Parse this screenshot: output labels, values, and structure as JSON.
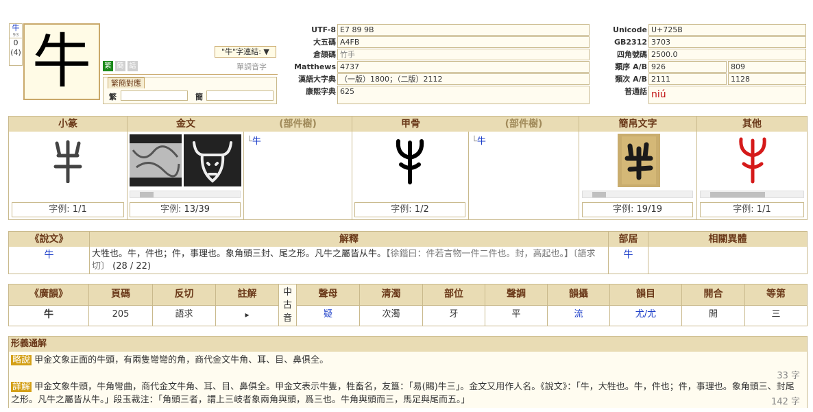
{
  "header": {
    "main_char": "牛",
    "mini_char": "牛",
    "mini_num": "93",
    "stroke_zero": "0",
    "stroke_total": "(4)",
    "btn_trad": "繁",
    "btn_simp": "簡",
    "btn_other": "話",
    "link_select": "\"牛\"字連結: ▼",
    "single_font": "單調音字",
    "tab_label": "繁簡對應",
    "trad_label": "繁",
    "simp_label": "簡"
  },
  "codes_left": [
    {
      "label": "UTF-8",
      "value": "E7 89 9B"
    },
    {
      "label": "大五碼",
      "value": "A4FB"
    },
    {
      "label": "倉頡碼",
      "value": "竹手"
    },
    {
      "label": "Matthews",
      "value": "4737"
    },
    {
      "label": "漢語大字典",
      "value": "（一版）1800；（二版）2112"
    },
    {
      "label": "康熙字典",
      "value": "625"
    }
  ],
  "codes_right": [
    {
      "label": "Unicode",
      "value": "U+725B"
    },
    {
      "label": "GB2312",
      "value": "3703"
    },
    {
      "label": "四角號碼",
      "value": "2500.0"
    },
    {
      "label": "類序 A/B",
      "value": "926",
      "value2": "809"
    },
    {
      "label": "類次 A/B",
      "value": "2111",
      "value2": "1128"
    },
    {
      "label": "普通話",
      "value": "niú"
    }
  ],
  "scripts": {
    "headers": [
      "小篆",
      "金文",
      "(部件樹)",
      "甲骨",
      "(部件樹)",
      "簡帛文字",
      "其他"
    ],
    "tree_char_1": "牛",
    "tree_char_2": "牛",
    "counts": [
      {
        "prefix": "字例: ",
        "value": "1/1"
      },
      {
        "prefix": "字例: ",
        "value": "13/39"
      },
      {
        "prefix": "字例: ",
        "value": "1/2"
      },
      {
        "prefix": "字例: ",
        "value": "19/19"
      },
      {
        "prefix": "字例: ",
        "value": "1/1"
      }
    ]
  },
  "shuowen": {
    "headers": [
      "《說文》",
      "解釋",
      "部居",
      "相關異體"
    ],
    "char": "牛",
    "text_main": "大牲也。牛，件也；件，事理也。象角頭三封、尾之形。凡牛之屬皆从牛。",
    "text_note": "【徐鍇曰：件若言物一件二件也。封，高起也。】〔語求切〕",
    "text_ref": "(28 / 22)",
    "radical": "牛",
    "variants": ""
  },
  "guangyun": {
    "headers": [
      "《廣韻》",
      "頁碼",
      "反切",
      "註解",
      "聲母",
      "清濁",
      "部位",
      "聲調",
      "韻攝",
      "韻目",
      "開合",
      "等第"
    ],
    "middle_label": "中古音",
    "values": [
      "牛",
      "205",
      "語求",
      "▸",
      "疑",
      "次濁",
      "牙",
      "平",
      "流",
      "尤/尤",
      "開",
      "三"
    ]
  },
  "xingyi": {
    "title": "形義通解",
    "brief_tag": "略說",
    "brief_text": "甲金文象正面的牛頭，有兩隻彎彎的角，商代金文牛角、耳、目、鼻俱全。",
    "brief_count": "33 字",
    "detail_tag": "詳解",
    "detail_text": "甲金文象牛頭，牛角彎曲，商代金文牛角、耳、目、鼻俱全。甲金文表示牛隻，牲畜名，友簋：「易(賜)牛三」。金文又用作人名。《說文》：「牛，大牲也。牛，件也；件，事理也。象角頭三、封尾之形。凡牛之屬皆从牛。」段玉裁注：「角頭三者，謂上三岐者象兩角與頭，爲三也。牛角與頭而三，馬足與尾而五。」",
    "detail_count": "142 字"
  }
}
